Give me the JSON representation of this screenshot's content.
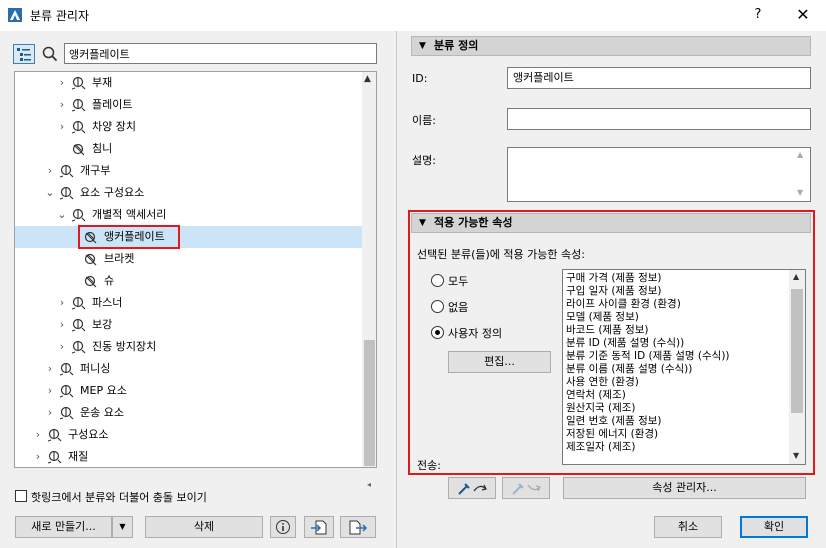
{
  "window": {
    "title": "분류 관리자",
    "help": "?",
    "close": "✕"
  },
  "search": {
    "value": "앵커플레이트"
  },
  "tree": [
    {
      "label": "부재",
      "depth": 3,
      "chev": "›",
      "icon": "classification-icon"
    },
    {
      "label": "플레이트",
      "depth": 3,
      "chev": "›",
      "icon": "classification-icon"
    },
    {
      "label": "차양 장치",
      "depth": 3,
      "chev": "›",
      "icon": "classification-icon"
    },
    {
      "label": "침니",
      "depth": 3,
      "chev": "",
      "icon": "classification-disabled-icon"
    },
    {
      "label": "개구부",
      "depth": 2,
      "chev": "›",
      "icon": "classification-icon"
    },
    {
      "label": "요소 구성요소",
      "depth": 2,
      "chev": "⌄",
      "icon": "classification-icon"
    },
    {
      "label": "개별적 액세서리",
      "depth": 3,
      "chev": "⌄",
      "icon": "classification-icon"
    },
    {
      "label": "앵커플레이트",
      "depth": 4,
      "chev": "",
      "icon": "classification-disabled-icon",
      "selected": true
    },
    {
      "label": "브라켓",
      "depth": 4,
      "chev": "",
      "icon": "classification-disabled-icon"
    },
    {
      "label": "슈",
      "depth": 4,
      "chev": "",
      "icon": "classification-disabled-icon"
    },
    {
      "label": "파스너",
      "depth": 3,
      "chev": "›",
      "icon": "classification-icon"
    },
    {
      "label": "보강",
      "depth": 3,
      "chev": "›",
      "icon": "classification-icon"
    },
    {
      "label": "진동 방지장치",
      "depth": 3,
      "chev": "›",
      "icon": "classification-icon"
    },
    {
      "label": "퍼니싱",
      "depth": 2,
      "chev": "›",
      "icon": "classification-icon"
    },
    {
      "label": "MEP 요소",
      "depth": 2,
      "chev": "›",
      "icon": "classification-icon"
    },
    {
      "label": "운송 요소",
      "depth": 2,
      "chev": "›",
      "icon": "classification-icon"
    },
    {
      "label": "구성요소",
      "depth": 1,
      "chev": "›",
      "icon": "classification-icon"
    },
    {
      "label": "재질",
      "depth": 1,
      "chev": "›",
      "icon": "classification-icon"
    }
  ],
  "left_footer": {
    "hotlink_label": "핫링크에서 분류와 더불어 충돌 보이기",
    "new_label": "새로 만들기...",
    "delete_label": "삭제"
  },
  "definition": {
    "header": "분류 정의",
    "id_label": "ID:",
    "id_value": "앵커플레이트",
    "name_label": "이름:",
    "name_value": "",
    "desc_label": "설명:",
    "desc_value": ""
  },
  "properties": {
    "header": "적용 가능한 속성",
    "desc": "선택된 분류(들)에 적용 가능한 속성:",
    "radios": [
      {
        "label": "모두",
        "checked": false
      },
      {
        "label": "없음",
        "checked": false
      },
      {
        "label": "사용자 정의",
        "checked": true
      }
    ],
    "edit_label": "편집...",
    "transfer_label": "전송:",
    "list": [
      "구매 가격 (제품 정보)",
      "구입 일자 (제품 정보)",
      "라이프 사이클 환경 (환경)",
      "모델 (제품 정보)",
      "바코드 (제품 정보)",
      "분류 ID (제품 설명 (수식))",
      "분류 기준 동적 ID (제품 설명 (수식))",
      "분류 이름 (제품 설명 (수식))",
      "사용 연한 (환경)",
      "연락처 (제조)",
      "원산지국 (제조)",
      "일련 번호 (제품 정보)",
      "저장된 에너지 (환경)",
      "제조일자 (제조)"
    ]
  },
  "right_footer": {
    "property_manager_label": "속성 관리자...",
    "cancel_label": "취소",
    "ok_label": "확인"
  },
  "colors": {
    "highlight": "#e0191f",
    "selection": "#cce4f7",
    "accent": "#0078d7"
  }
}
